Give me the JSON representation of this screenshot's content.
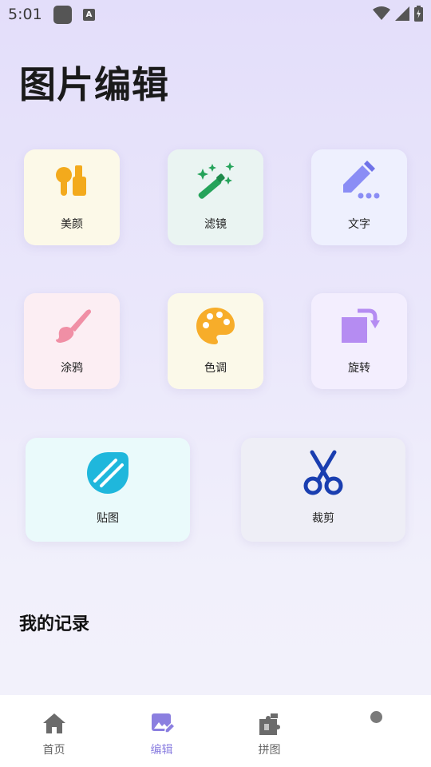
{
  "status_bar": {
    "time": "5:01",
    "a_icon_text": "A",
    "icons": [
      "app-icon",
      "a-icon",
      "wifi-icon",
      "signal-icon",
      "battery-icon"
    ]
  },
  "page": {
    "title": "图片编辑"
  },
  "tools": [
    {
      "label": "美颜",
      "icon": "beauty-icon",
      "bg": "#fcf9e8",
      "color": "#f3aa1c"
    },
    {
      "label": "滤镜",
      "icon": "magic-wand-icon",
      "bg": "#eaf4f2",
      "color": "#25a35a"
    },
    {
      "label": "文字",
      "icon": "pencil-icon",
      "bg": "#eef0fe",
      "color": "#8a8df5"
    },
    {
      "label": "涂鸦",
      "icon": "brush-icon",
      "bg": "#fceef3",
      "color": "#f08fa5"
    },
    {
      "label": "色调",
      "icon": "palette-icon",
      "bg": "#fbf9e9",
      "color": "#f7ad2a"
    },
    {
      "label": "旋转",
      "icon": "rotate-icon",
      "bg": "#f3eefe",
      "color": "#b58cf2"
    },
    {
      "label": "贴图",
      "icon": "sticker-icon",
      "bg": "#eafafb",
      "color": "#1fb7dc"
    },
    {
      "label": "裁剪",
      "icon": "scissors-icon",
      "bg": "#eeeef6",
      "color": "#1a3eb0"
    }
  ],
  "records": {
    "title": "我的记录"
  },
  "bottom_nav": {
    "items": [
      {
        "label": "首页",
        "icon": "home-icon",
        "active": false
      },
      {
        "label": "编辑",
        "icon": "edit-image-icon",
        "active": true
      },
      {
        "label": "拼图",
        "icon": "puzzle-icon",
        "active": false
      }
    ],
    "active_color": "#8b7fe0",
    "inactive_color": "#666666"
  }
}
